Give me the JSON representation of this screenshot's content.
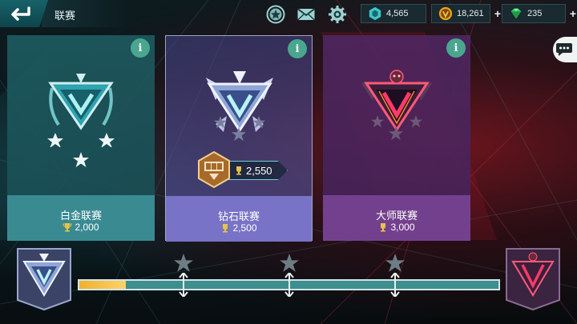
{
  "header": {
    "title": "联赛",
    "icons": [
      "star-badge-icon",
      "mail-icon",
      "gear-icon"
    ]
  },
  "currencies": [
    {
      "name": "cores",
      "value": "4,565",
      "icon": "hex-chip-icon",
      "color": "#3fc7c9"
    },
    {
      "name": "credits",
      "value": "18,261",
      "icon": "gold-v-coin-icon",
      "color": "#f0a319"
    },
    {
      "name": "gems",
      "value": "235",
      "icon": "green-gem-icon",
      "color": "#33d06a"
    }
  ],
  "leagues": [
    {
      "id": "platinum",
      "name": "白金联赛",
      "requirement": "2,000",
      "info": "i"
    },
    {
      "id": "diamond",
      "name": "钻石联赛",
      "requirement": "2,500",
      "info": "i"
    },
    {
      "id": "master",
      "name": "大师联赛",
      "requirement": "3,000",
      "info": "i"
    }
  ],
  "current_rank": {
    "trophies": "2,550"
  },
  "progress": {
    "fraction": 0.11,
    "milestone_stars": 3
  },
  "colors": {
    "teal": "#3a8a92",
    "diamond": "#7873c6",
    "master": "#73408d",
    "gold": "#f0b030"
  }
}
